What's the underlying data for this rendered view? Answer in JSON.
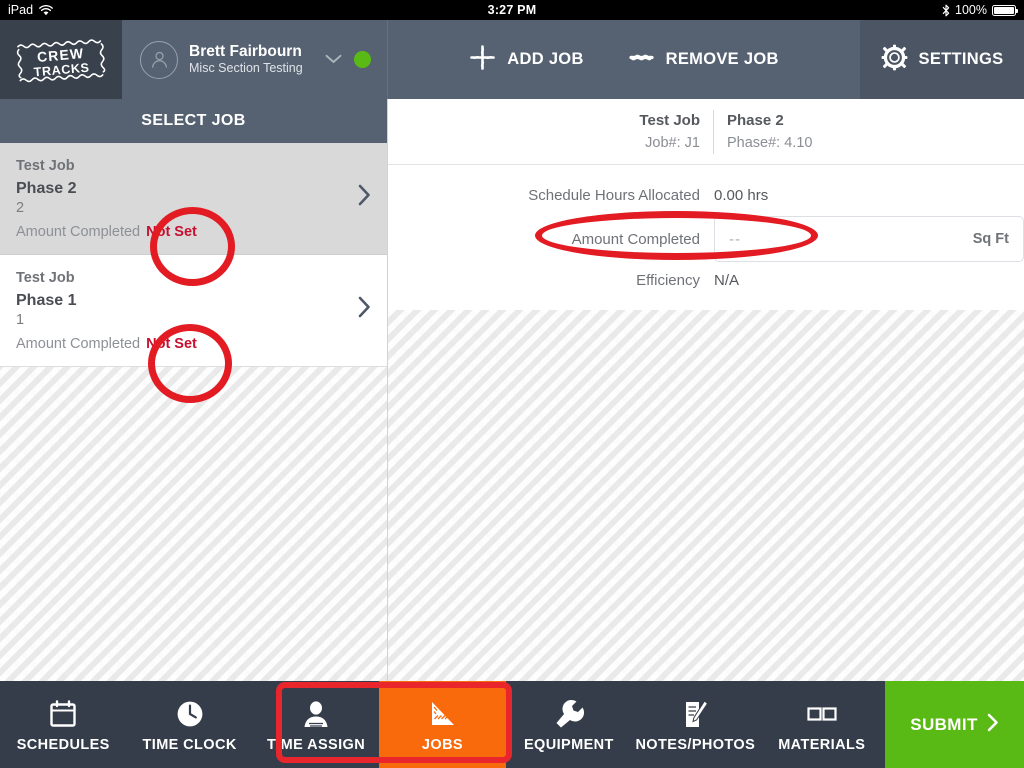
{
  "status_bar": {
    "device": "iPad",
    "wifi_icon": "wifi-icon",
    "time": "3:27 PM",
    "bluetooth_icon": "bluetooth-icon",
    "battery_percent": "100%"
  },
  "header": {
    "logo_text": "CREW TRACKS",
    "user": {
      "name": "Brett Fairbourn",
      "crew": "Misc Section Testing",
      "avatar_icon": "user-avatar-icon",
      "chevron_icon": "chevron-down-icon",
      "status_dot_color": "#5aba15"
    },
    "actions": [
      {
        "label": "ADD JOB",
        "icon": "add-job-icon"
      },
      {
        "label": "REMOVE JOB",
        "icon": "remove-job-icon"
      }
    ],
    "settings": {
      "label": "SETTINGS",
      "icon": "gear-icon"
    }
  },
  "sidebar": {
    "title": "SELECT JOB",
    "amount_label": "Amount Completed",
    "jobs": [
      {
        "job": "Test Job",
        "phase": "Phase 2",
        "number": "2",
        "amount_label": "Amount Completed",
        "amount_value": "Not Set",
        "selected": true,
        "chevron_icon": "chevron-right-icon"
      },
      {
        "job": "Test Job",
        "phase": "Phase 1",
        "number": "1",
        "amount_label": "Amount Completed",
        "amount_value": "Not Set",
        "selected": false,
        "chevron_icon": "chevron-right-icon"
      }
    ]
  },
  "detail": {
    "job_name": "Test Job",
    "job_number": "Job#: J1",
    "phase_name": "Phase 2",
    "phase_number": "Phase#: 4.10",
    "fields": [
      {
        "label": "Schedule Hours Allocated",
        "value": "0.00 hrs"
      },
      {
        "label": "Efficiency",
        "value": "N/A"
      }
    ],
    "amount_completed": {
      "label": "Amount Completed",
      "value": "",
      "placeholder": "--",
      "unit": "Sq Ft"
    }
  },
  "bottom_nav": {
    "items": [
      {
        "label": "SCHEDULES",
        "icon": "calendar-icon",
        "active": false
      },
      {
        "label": "TIME CLOCK",
        "icon": "clock-icon",
        "active": false
      },
      {
        "label": "TIME ASSIGN",
        "icon": "person-icon",
        "active": false
      },
      {
        "label": "JOBS",
        "icon": "ruler-triangle-icon",
        "active": true
      },
      {
        "label": "EQUIPMENT",
        "icon": "wrench-icon",
        "active": false
      },
      {
        "label": "NOTES/PHOTOS",
        "icon": "notes-pencil-icon",
        "active": false
      },
      {
        "label": "MATERIALS",
        "icon": "materials-icon",
        "active": false
      }
    ],
    "submit": {
      "label": "SUBMIT",
      "icon": "chevron-right-icon",
      "color": "#5aba15"
    }
  },
  "annotations": {
    "highlight_color": "#e31b23",
    "shapes": [
      {
        "name": "circle-not-set-phase2",
        "type": "circle"
      },
      {
        "name": "circle-not-set-phase1",
        "type": "circle"
      },
      {
        "name": "oval-amount-completed",
        "type": "oval"
      },
      {
        "name": "rect-time-assign-jobs-tabs",
        "type": "rect"
      }
    ]
  }
}
